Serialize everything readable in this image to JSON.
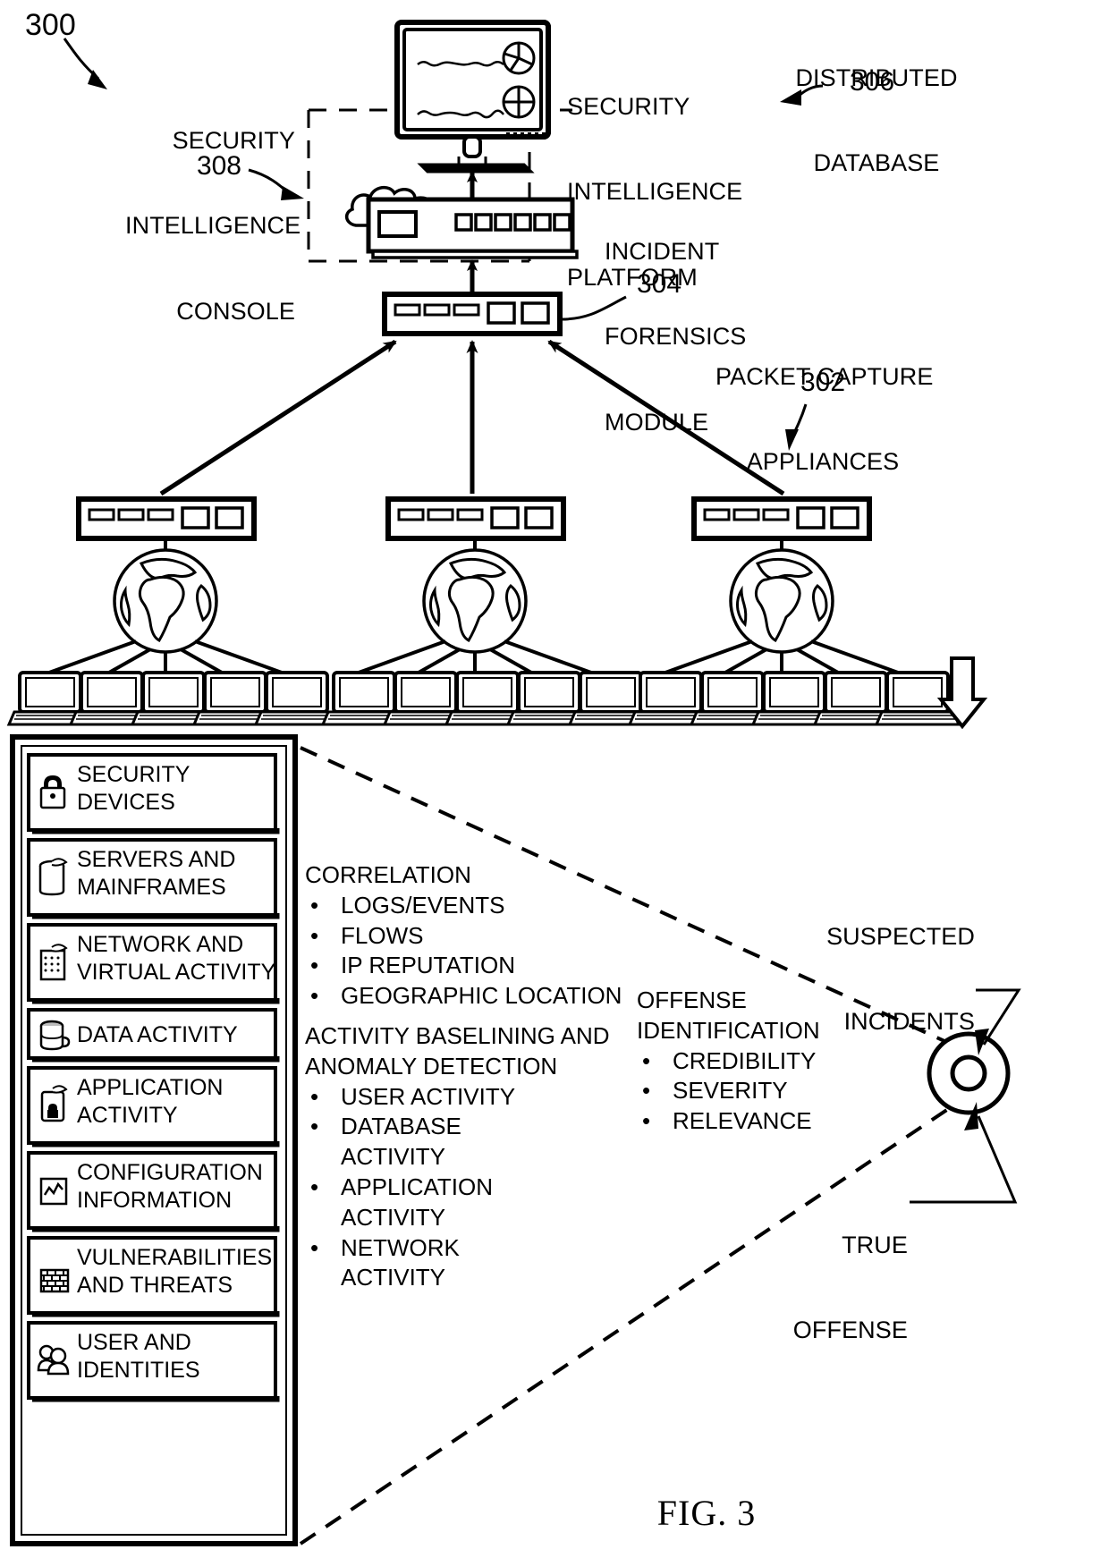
{
  "figure": {
    "caption": "FIG. 3",
    "root_ref": "300"
  },
  "callouts": {
    "security_intelligence_console": {
      "lines": [
        "SECURITY",
        "INTELLIGENCE",
        "CONSOLE"
      ],
      "ref": "308"
    },
    "security_intelligence_platform": {
      "lines": [
        "SECURITY",
        "INTELLIGENCE",
        "PLATFORM"
      ]
    },
    "distributed_database": {
      "lines": [
        "DISTRIBUTED",
        "DATABASE"
      ],
      "ref": "306"
    },
    "incident_forensics_module": {
      "lines": [
        "INCIDENT",
        "FORENSICS",
        "MODULE"
      ],
      "ref": "304"
    },
    "packet_capture_appliances": {
      "lines": [
        "PACKET CAPTURE",
        "APPLIANCES"
      ],
      "ref": "302"
    },
    "suspected_incidents": {
      "lines": [
        "SUSPECTED",
        "INCIDENTS"
      ]
    },
    "true_offense": {
      "lines": [
        "TRUE",
        "OFFENSE"
      ]
    }
  },
  "data_sources_panel": {
    "items": [
      {
        "icon": "lock-icon",
        "lines": [
          "SECURITY",
          "DEVICES"
        ]
      },
      {
        "icon": "server-icon",
        "lines": [
          "SERVERS AND",
          "MAINFRAMES"
        ]
      },
      {
        "icon": "network-icon",
        "lines": [
          "NETWORK AND",
          "VIRTUAL ACTIVITY"
        ]
      },
      {
        "icon": "database-icon",
        "lines": [
          "DATA ACTIVITY"
        ]
      },
      {
        "icon": "application-icon",
        "lines": [
          "APPLICATION",
          "ACTIVITY"
        ]
      },
      {
        "icon": "configuration-icon",
        "lines": [
          "CONFIGURATION",
          "INFORMATION"
        ]
      },
      {
        "icon": "brick-wall-icon",
        "lines": [
          "VULNERABILITIES",
          "AND THREATS"
        ]
      },
      {
        "icon": "users-icon",
        "lines": [
          "USER AND",
          "IDENTITIES"
        ]
      }
    ]
  },
  "analysis": {
    "correlation": {
      "heading_lines": [
        "CORRELATION"
      ],
      "bullets": [
        "LOGS/EVENTS",
        "FLOWS",
        "IP REPUTATION",
        "GEOGRAPHIC LOCATION"
      ]
    },
    "baselining": {
      "heading_lines": [
        "ACTIVITY BASELINING AND",
        "ANOMALY DETECTION"
      ],
      "bullets": [
        "USER ACTIVITY",
        "DATABASE\nACTIVITY",
        "APPLICATION\nACTIVITY",
        "NETWORK\nACTIVITY"
      ]
    },
    "offense_identification": {
      "heading_lines": [
        "OFFENSE",
        "IDENTIFICATION"
      ],
      "bullets": [
        "CREDIBILITY",
        "SEVERITY",
        "RELEVANCE"
      ]
    }
  },
  "colors": {
    "ink": "#000000",
    "paper": "#ffffff"
  }
}
